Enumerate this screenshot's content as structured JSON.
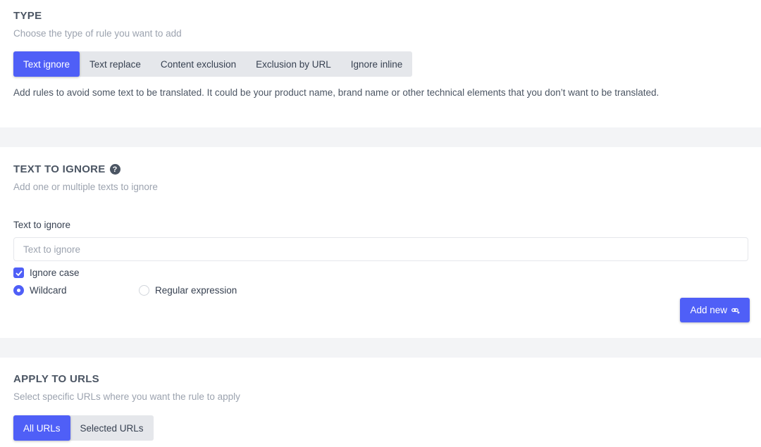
{
  "type_section": {
    "title": "TYPE",
    "subtitle": "Choose the type of rule you want to add",
    "tabs": [
      {
        "label": "Text ignore",
        "active": true
      },
      {
        "label": "Text replace",
        "active": false
      },
      {
        "label": "Content exclusion",
        "active": false
      },
      {
        "label": "Exclusion by URL",
        "active": false
      },
      {
        "label": "Ignore inline",
        "active": false
      }
    ],
    "description": "Add rules to avoid some text to be translated. It could be your product name, brand name or other technical elements that you don’t want to be translated."
  },
  "ignore_section": {
    "title": "TEXT TO IGNORE",
    "help_icon": "question-circle-icon",
    "subtitle": "Add one or multiple texts to ignore",
    "field_label": "Text to ignore",
    "field_placeholder": "Text to ignore",
    "field_value": "",
    "ignore_case_label": "Ignore case",
    "ignore_case_checked": true,
    "match_options": [
      {
        "label": "Wildcard",
        "selected": true
      },
      {
        "label": "Regular expression",
        "selected": false
      }
    ],
    "add_button_label": "Add new",
    "add_button_icon": "link-plus-icon"
  },
  "urls_section": {
    "title": "APPLY TO URLS",
    "subtitle": "Select specific URLs where you want the rule to apply",
    "tabs": [
      {
        "label": "All URLs",
        "active": true
      },
      {
        "label": "Selected URLs",
        "active": false
      }
    ]
  },
  "colors": {
    "accent": "#4f5ff7",
    "segment_bg": "#e5e7eb",
    "page_bg": "#f3f4f6"
  }
}
